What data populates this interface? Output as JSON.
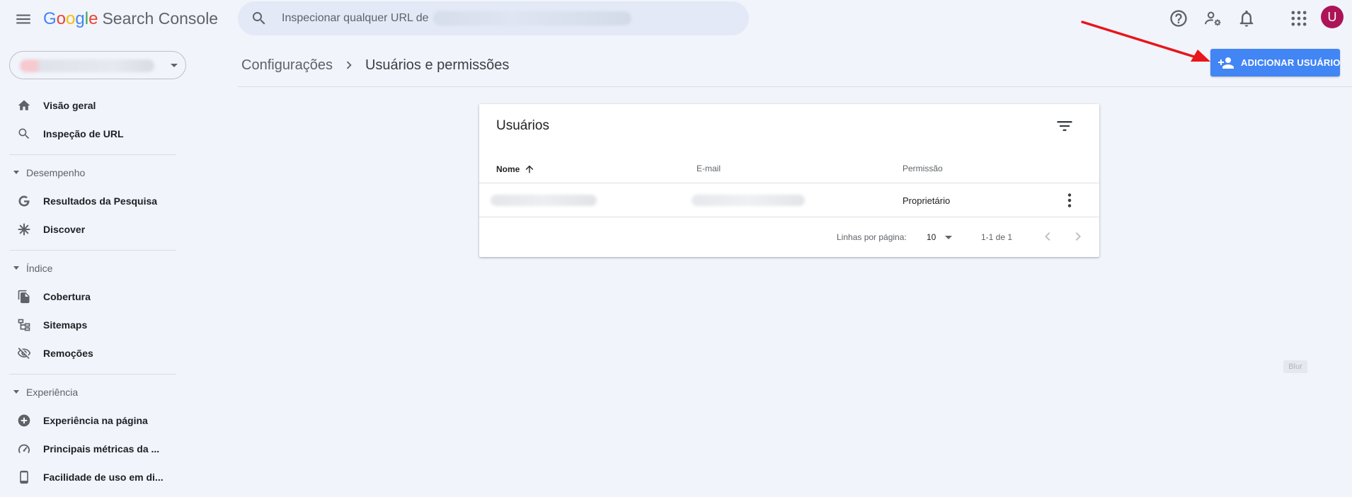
{
  "app": {
    "logo_letters": [
      "G",
      "o",
      "o",
      "g",
      "l",
      "e"
    ],
    "product": "Search Console"
  },
  "search": {
    "placeholder": "Inspecionar qualquer URL de"
  },
  "user": {
    "avatar_letter": "U",
    "avatar_color": "#ad1457"
  },
  "top_icons": [
    "help-icon",
    "manage-accounts-icon",
    "notifications-icon",
    "apps-icon"
  ],
  "sidebar": {
    "top_items": [
      {
        "label": "Visão geral",
        "icon": "home-icon"
      },
      {
        "label": "Inspeção de URL",
        "icon": "search-icon"
      }
    ],
    "sections": [
      {
        "title": "Desempenho",
        "items": [
          {
            "label": "Resultados da Pesquisa",
            "icon": "google-g-icon"
          },
          {
            "label": "Discover",
            "icon": "asterisk-icon"
          }
        ]
      },
      {
        "title": "Índice",
        "items": [
          {
            "label": "Cobertura",
            "icon": "file-copy-icon"
          },
          {
            "label": "Sitemaps",
            "icon": "sitemap-icon"
          },
          {
            "label": "Remoções",
            "icon": "visibility-off-icon"
          }
        ]
      },
      {
        "title": "Experiência",
        "items": [
          {
            "label": "Experiência na página",
            "icon": "add-circle-icon"
          },
          {
            "label": "Principais métricas da ...",
            "icon": "speed-icon"
          },
          {
            "label": "Facilidade de uso em di...",
            "icon": "smartphone-icon"
          }
        ]
      }
    ]
  },
  "header": {
    "breadcrumb": [
      "Configurações",
      "Usuários e permissões"
    ],
    "add_user_label": "ADICIONAR USUÁRIO",
    "accent": "#4285f4"
  },
  "users_card": {
    "title": "Usuários",
    "columns": {
      "name": "Nome",
      "email": "E-mail",
      "permission": "Permissão"
    },
    "rows": [
      {
        "permission": "Proprietário"
      }
    ],
    "pagination": {
      "rows_per_page_label": "Linhas por página:",
      "rows_per_page": "10",
      "range": "1-1 de 1"
    }
  },
  "misc": {
    "blur_chip": "Blur"
  },
  "annotation": {
    "arrow_color": "#e8151b"
  }
}
